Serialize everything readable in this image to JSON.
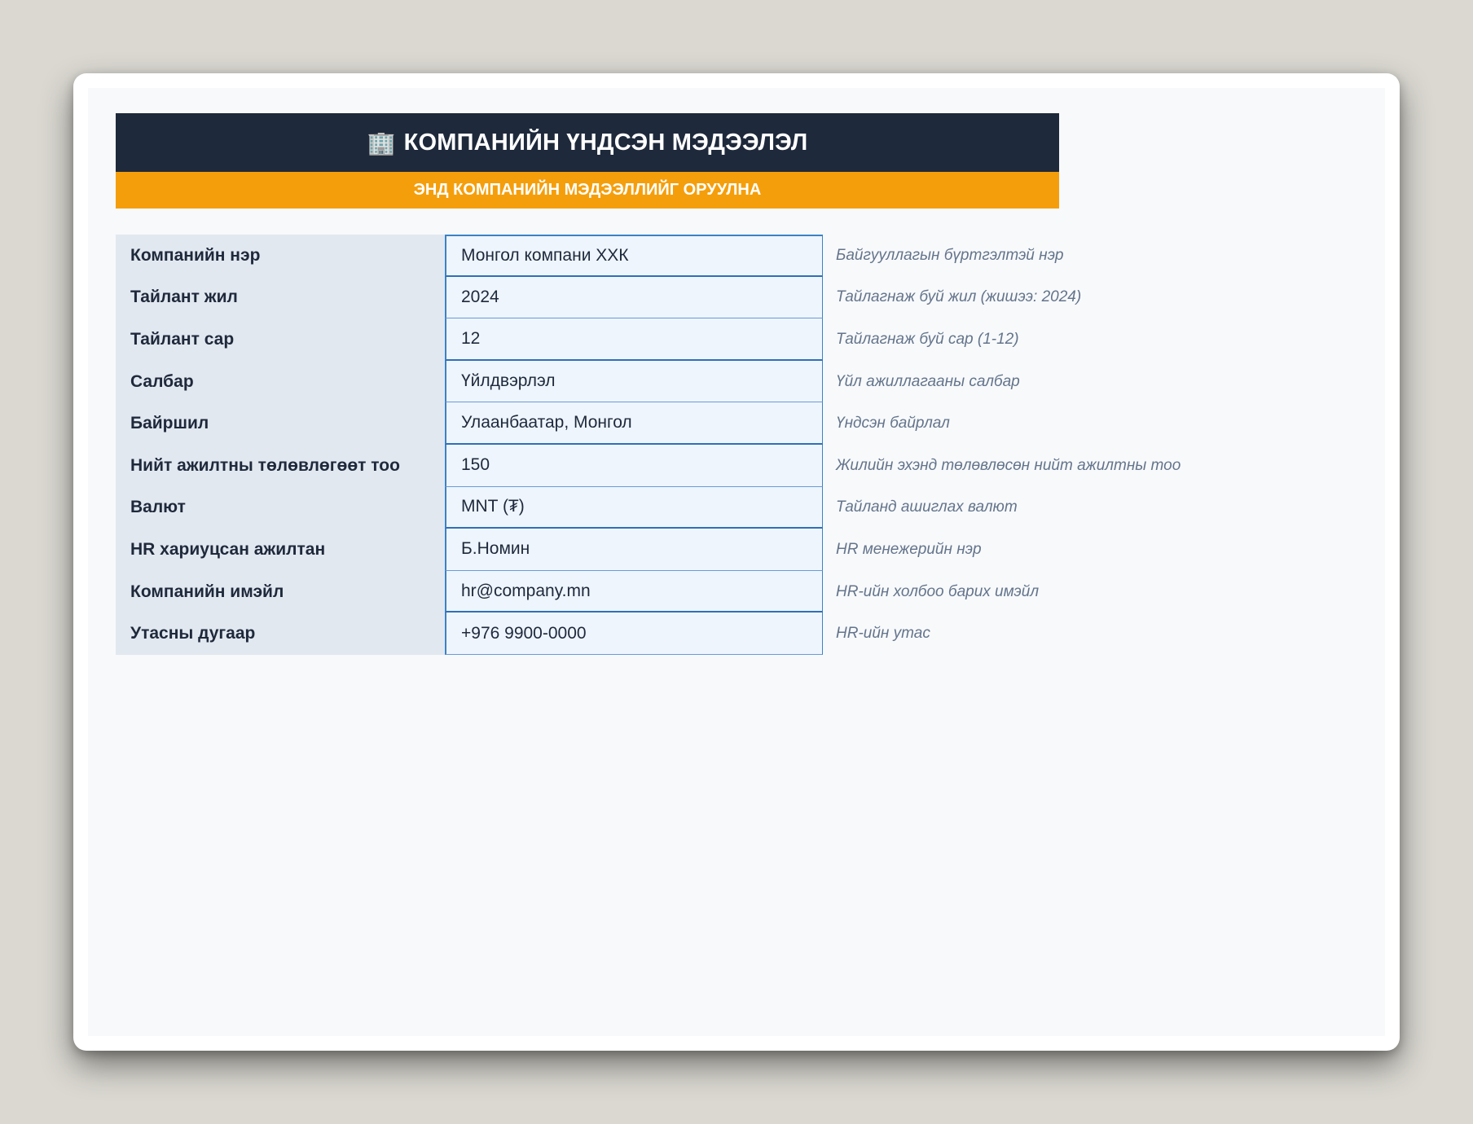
{
  "header": {
    "icon": "building-icon",
    "icon_glyph": "🏢",
    "title": "КОМПАНИЙН ҮНДСЭН МЭДЭЭЛЭЛ",
    "subtitle": "ЭНД КОМПАНИЙН МЭДЭЭЛЛИЙГ ОРУУЛНА"
  },
  "rows": [
    {
      "label": "Компанийн нэр",
      "value": "Монгол компани ХХК",
      "note": "Байгууллагын бүртгэлтэй нэр"
    },
    {
      "label": "Тайлант жил",
      "value": "2024",
      "note": "Тайлагнаж буй жил (жишээ: 2024)"
    },
    {
      "label": "Тайлант сар",
      "value": "12",
      "note": "Тайлагнаж буй сар (1-12)"
    },
    {
      "label": "Салбар",
      "value": "Үйлдвэрлэл",
      "note": "Үйл ажиллагааны салбар"
    },
    {
      "label": "Байршил",
      "value": "Улаанбаатар, Монгол",
      "note": "Үндсэн байрлал"
    },
    {
      "label": "Нийт ажилтны төлөвлөгөөт тоо",
      "value": "150",
      "note": "Жилийн эхэнд төлөвлөсөн нийт ажилтны тоо"
    },
    {
      "label": "Валют",
      "value": "MNT (₮)",
      "note": "Тайланд ашиглах валют"
    },
    {
      "label": "HR хариуцсан ажилтан",
      "value": "Б.Номин",
      "note": "HR менежерийн нэр"
    },
    {
      "label": "Компанийн имэйл",
      "value": "hr@company.mn",
      "note": "HR-ийн холбоо барих имэйл"
    },
    {
      "label": "Утасны дугаар",
      "value": "+976 9900-0000",
      "note": "HR-ийн утас"
    }
  ],
  "colors": {
    "header_bg": "#1e293b",
    "subheader_bg": "#f59e0b",
    "label_bg": "#e2e8f0",
    "input_bg": "#eef5fd",
    "input_border": "#3b82c4",
    "note_text": "#64748b"
  }
}
